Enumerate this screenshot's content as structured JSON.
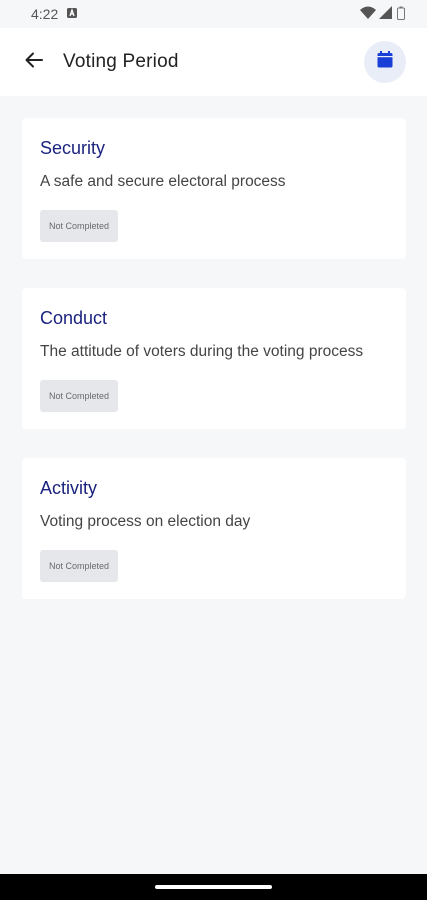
{
  "status_bar": {
    "time": "4:22"
  },
  "app_bar": {
    "title": "Voting Period"
  },
  "cards": [
    {
      "title": "Security",
      "description": "A safe and secure electoral process",
      "status": "Not Completed"
    },
    {
      "title": "Conduct",
      "description": "The attitude of voters during the voting process",
      "status": "Not Completed"
    },
    {
      "title": "Activity",
      "description": "Voting process on election day",
      "status": "Not Completed"
    }
  ],
  "colors": {
    "accent": "#1a3fd6",
    "title": "#1a237e",
    "background": "#f6f7f9"
  }
}
